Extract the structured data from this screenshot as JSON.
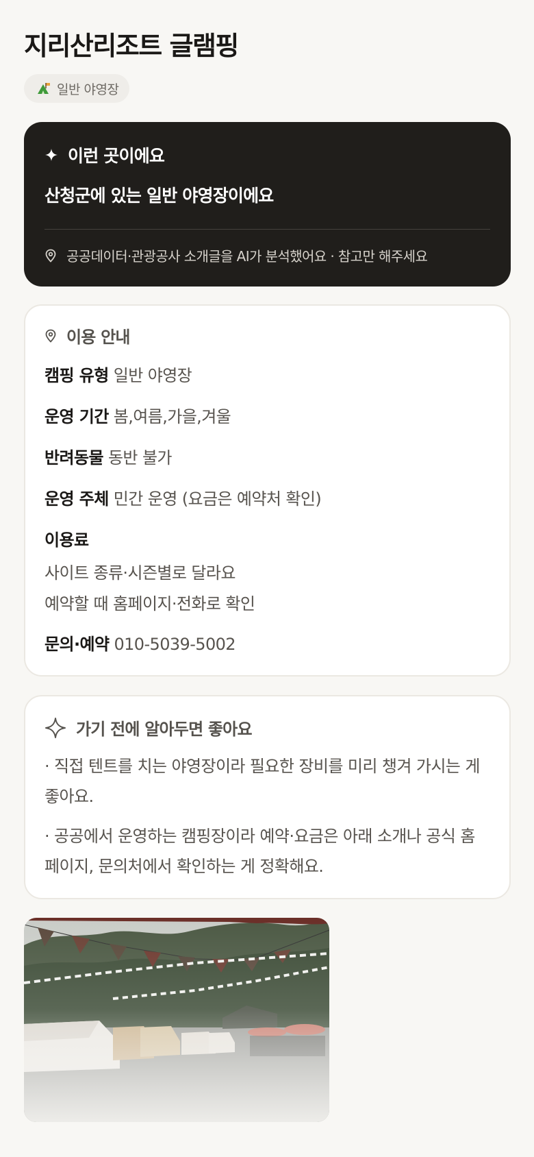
{
  "header": {
    "title": "지리산리조트 글램핑",
    "category_chip": {
      "label": "일반 야영장",
      "icon": "camping-tent-icon"
    }
  },
  "summary_card": {
    "heading": "이런 곳이에요",
    "heading_icon": "sparkle-icon",
    "summary": "산청군에 있는 일반 야영장이에요",
    "note": "공공데이터·관광공사 소개글을 AI가 분석했어요 · 참고만 해주세요",
    "note_icon": "location-pin-icon"
  },
  "info_card": {
    "heading": "이용 안내",
    "heading_icon": "location-pin-icon",
    "rows": [
      {
        "key": "캠핑 유형",
        "value": "일반 야영장"
      },
      {
        "key": "운영 기간",
        "value": "봄,여름,가을,겨울"
      },
      {
        "key": "반려동물",
        "value": "동반 불가"
      },
      {
        "key": "운영 주체",
        "value": "민간 운영 (요금은 예약처 확인)"
      }
    ],
    "fee": {
      "key": "이용료",
      "lines": [
        "사이트 종류·시즌별로 달라요",
        "예약할 때 홈페이지·전화로 확인"
      ]
    },
    "contact": {
      "key": "문의·예약",
      "value": "010-5039-5002"
    }
  },
  "tips_card": {
    "heading": "가기 전에 알아두면 좋아요",
    "heading_icon": "sparkle-outline-icon",
    "tips": [
      "· 직접 텐트를 치는 야영장이라 필요한 장비를 미리 챙겨 가시는 게 좋아요.",
      "· 공공에서 운영하는 캠핑장이라 예약·요금은 아래 소개나 공식 홈페이지, 문의처에서 확인하는 게 정확해요."
    ]
  },
  "colors": {
    "background": "#f8f7f4",
    "dark_card": "#201e1b",
    "card_border": "#ebe8e2",
    "chip_background": "#efede9"
  }
}
